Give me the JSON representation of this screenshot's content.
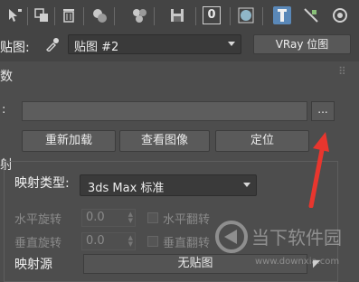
{
  "toolbar": {
    "icons": [
      "pick-icon",
      "copy-icon",
      "delete-icon",
      "material-icon",
      "material-map-icon",
      "save-icon",
      "channel-icon",
      "sphere-icon",
      "highlight-icon",
      "navigate-icon",
      "options-icon"
    ],
    "channel_value": "0"
  },
  "map": {
    "label": "贴图:",
    "selected": "贴图 #2",
    "type_button": "VRay 位图"
  },
  "rollout": {
    "header": "数",
    "browse_label": "...",
    "buttons": [
      "重新加载",
      "查看图像",
      "定位"
    ]
  },
  "mapping": {
    "side_header": "射",
    "type_label": "映射类型:",
    "type_value": "3ds Max 标准",
    "h_rotate_label": "水平旋转",
    "h_rotate_value": "0.0",
    "h_flip_label": "水平翻转",
    "v_rotate_label": "垂直旋转",
    "v_rotate_value": "0.0",
    "v_flip_label": "垂直翻转",
    "source_label": "映射源",
    "source_value": "无贴图"
  },
  "left_edge": {
    "colon": ":"
  },
  "watermark": {
    "title": "当下软件园",
    "url": "www.downxia.com"
  },
  "colors": {
    "background": "#444444",
    "panel": "#4d4d4d",
    "active_icon": "#5a88b8",
    "arrow": "#e8362e"
  }
}
